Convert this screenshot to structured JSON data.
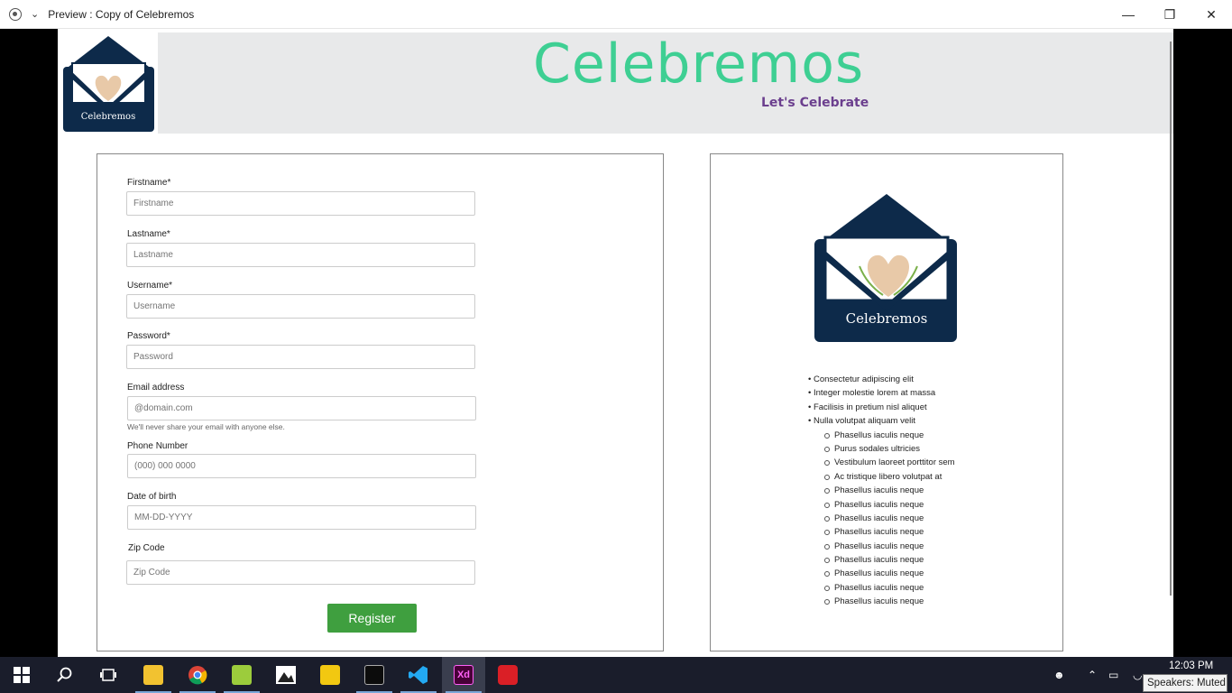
{
  "window": {
    "title": "Preview : Copy of Celebremos"
  },
  "header": {
    "brand": "Celebremos",
    "tagline": "Let's Celebrate",
    "logo_text": "Celebremos"
  },
  "form": {
    "fields": [
      {
        "label": "Firstname*",
        "placeholder": "Firstname"
      },
      {
        "label": "Lastname*",
        "placeholder": "Lastname"
      },
      {
        "label": "Username*",
        "placeholder": "Username"
      },
      {
        "label": "Password*",
        "placeholder": "Password"
      },
      {
        "label": "Email address",
        "placeholder": "@domain.com",
        "help": "We'll never share your email with anyone else."
      },
      {
        "label": "Phone Number",
        "placeholder": "(000) 000 0000"
      },
      {
        "label": "Date of birth",
        "placeholder": "MM-DD-YYYY"
      },
      {
        "label": "Zip Code",
        "placeholder": "Zip Code"
      }
    ],
    "register_label": "Register"
  },
  "info": {
    "logo_text": "Celebremos",
    "bullets": [
      "Consectetur adipiscing elit",
      "Integer molestie lorem at massa",
      "Facilisis in pretium nisl aliquet",
      "Nulla volutpat aliquam velit"
    ],
    "sub_bullets": [
      "Phasellus iaculis neque",
      "Purus sodales ultricies",
      "Vestibulum laoreet porttitor sem",
      "Ac tristique libero volutpat at",
      "Phasellus iaculis neque",
      "Phasellus iaculis neque",
      "Phasellus iaculis neque",
      "Phasellus iaculis neque",
      "Phasellus iaculis neque",
      "Phasellus iaculis neque",
      "Phasellus iaculis neque",
      "Phasellus iaculis neque",
      "Phasellus iaculis neque"
    ]
  },
  "taskbar": {
    "apps": [
      "start-icon",
      "search-icon",
      "task-view-icon",
      "file-explorer-icon",
      "chrome-icon",
      "notepad-plus-icon",
      "photos-icon",
      "power-bi-icon",
      "terminal-icon",
      "vscode-icon",
      "adobe-xd-icon",
      "creative-cloud-icon"
    ],
    "clock": "12:03 PM",
    "tooltip": "Speakers: Muted"
  },
  "colors": {
    "brand_green": "#3ecf93",
    "tagline_purple": "#6b3f8e",
    "logo_navy": "#0d2a4a",
    "register_green": "#3f9f3f"
  }
}
